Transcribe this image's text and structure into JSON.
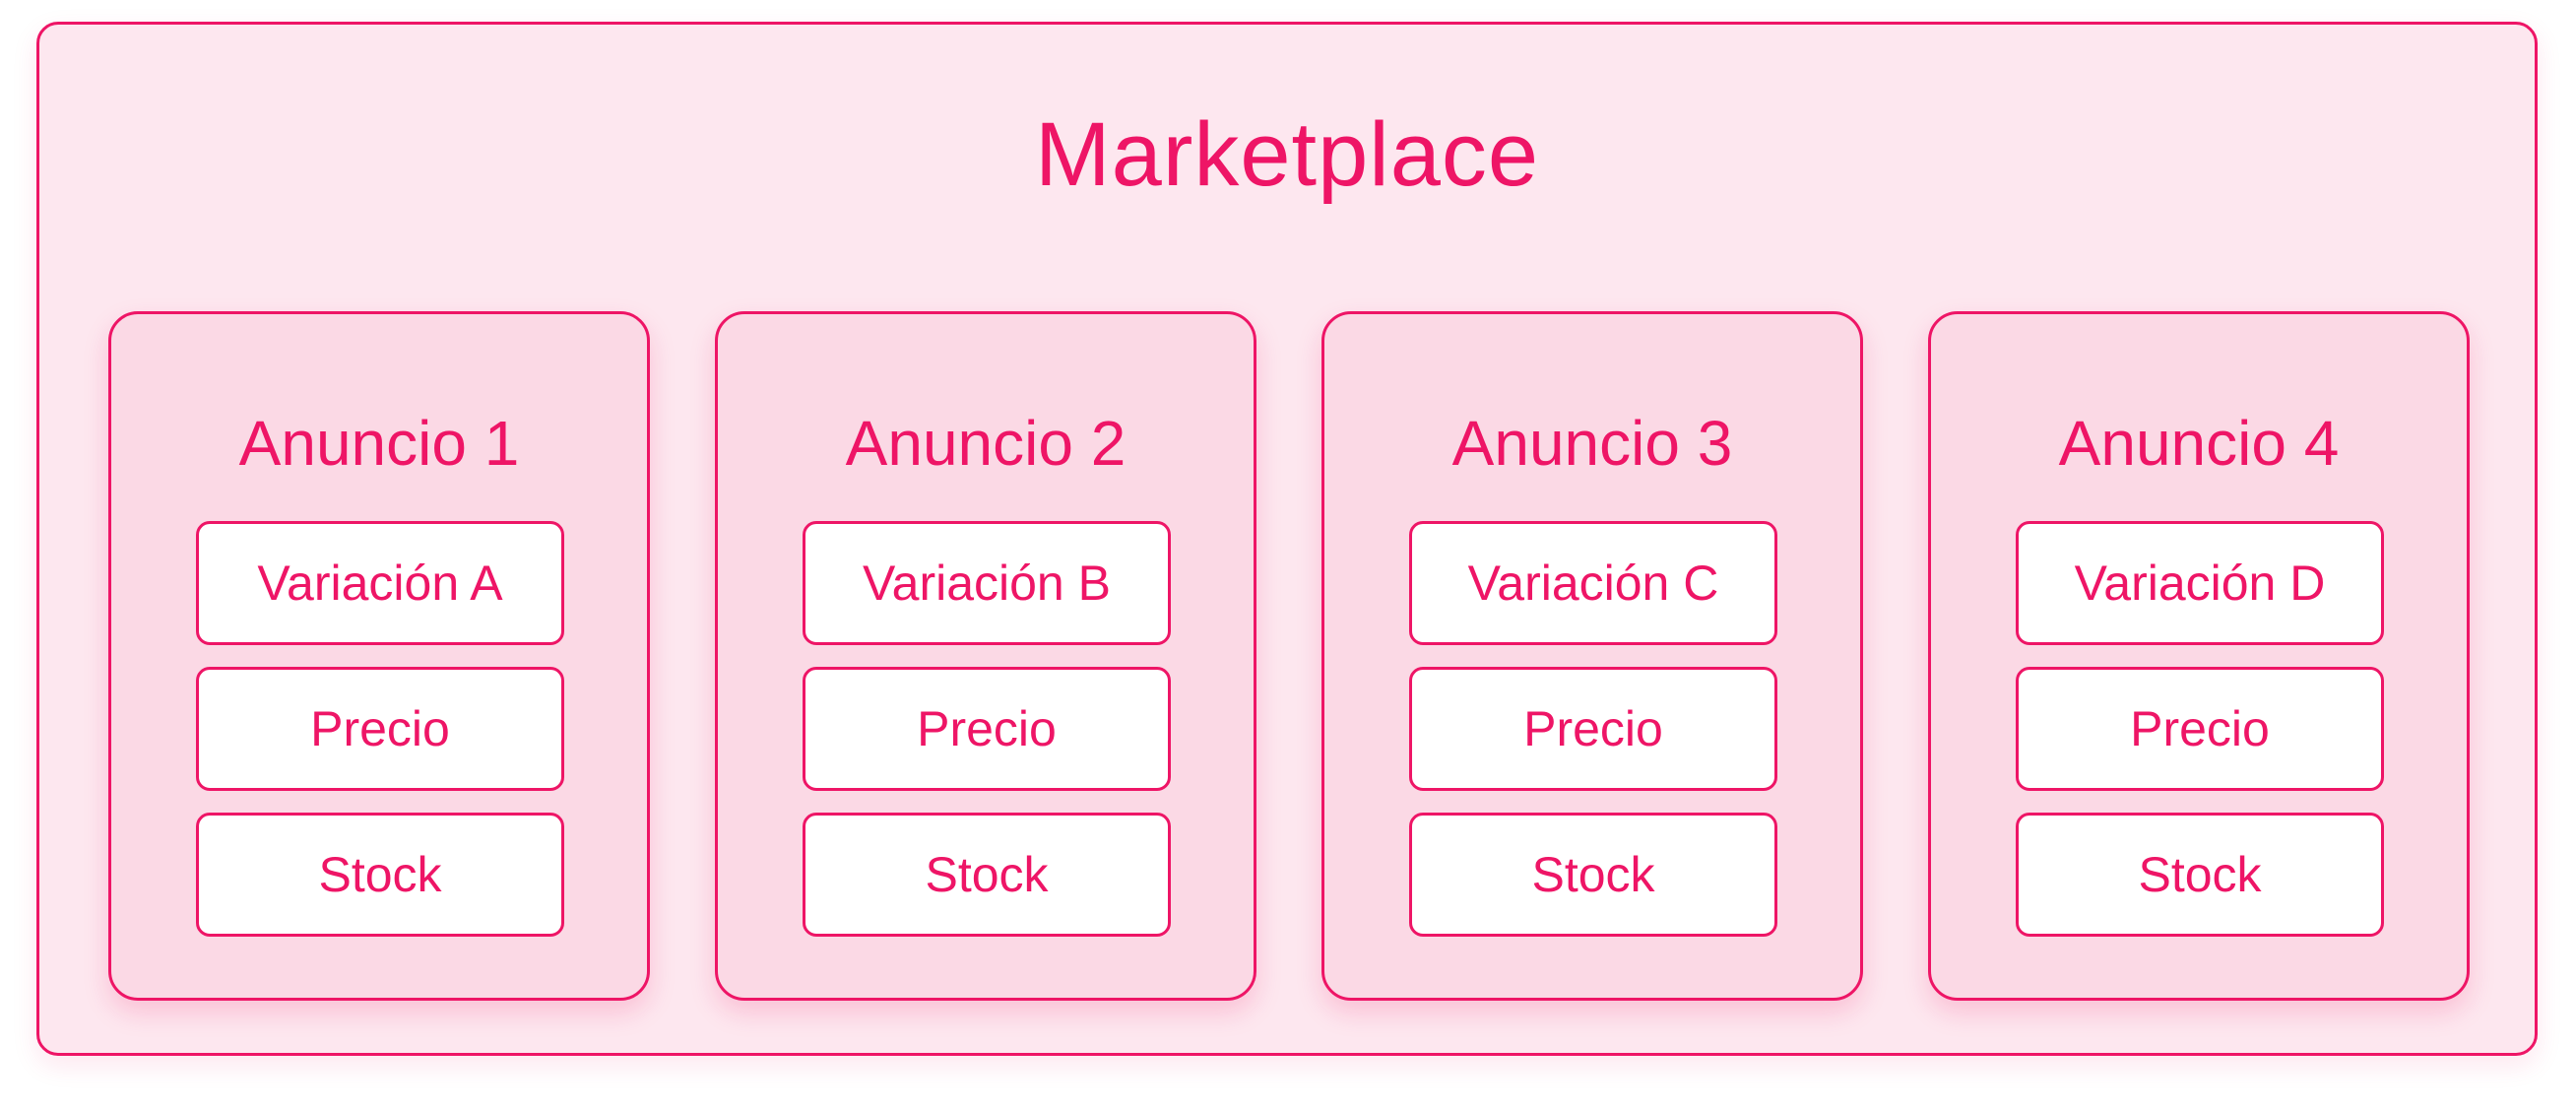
{
  "marketplace": {
    "title": "Marketplace"
  },
  "listings": [
    {
      "title": "Anuncio 1",
      "variation": "Variación A",
      "price_label": "Precio",
      "stock_label": "Stock"
    },
    {
      "title": "Anuncio 2",
      "variation": "Variación B",
      "price_label": "Precio",
      "stock_label": "Stock"
    },
    {
      "title": "Anuncio 3",
      "variation": "Variación C",
      "price_label": "Precio",
      "stock_label": "Stock"
    },
    {
      "title": "Anuncio 4",
      "variation": "Variación D",
      "price_label": "Precio",
      "stock_label": "Stock"
    }
  ],
  "colors": {
    "accent": "#ee1566",
    "outer_fill": "#fde7ef",
    "card_fill": "#fbd9e5",
    "box_fill": "#ffffff"
  }
}
